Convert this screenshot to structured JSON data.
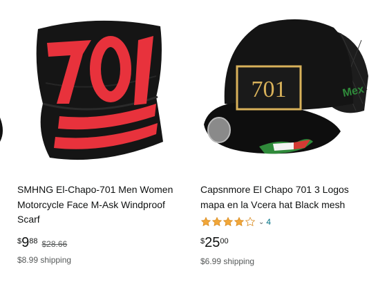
{
  "products": [
    {
      "image_alt": "black face mask scarf with red 701 print",
      "title": "SMHNG El-Chapo-701 Men Women Motorcycle Face M-Ask Windproof Scarf",
      "price": {
        "symbol": "$",
        "whole": "9",
        "fraction": "88"
      },
      "list_price": "$28.66",
      "shipping": "$8.99 shipping"
    },
    {
      "image_alt": "black mesh trucker hat with gold 701 patch",
      "title": "Capsnmore El Chapo 701 3 Logos mapa en la Vcera hat Black mesh",
      "rating": {
        "stars": 4,
        "count": "4",
        "star_color": "#f1a73a"
      },
      "price": {
        "symbol": "$",
        "whole": "25",
        "fraction": "00"
      },
      "shipping": "$6.99 shipping"
    }
  ],
  "hat_text": {
    "patch": "701",
    "side": "Mex"
  },
  "colors": {
    "accent_red": "#e8323c",
    "gold": "#d8b15a",
    "link": "#007185"
  }
}
